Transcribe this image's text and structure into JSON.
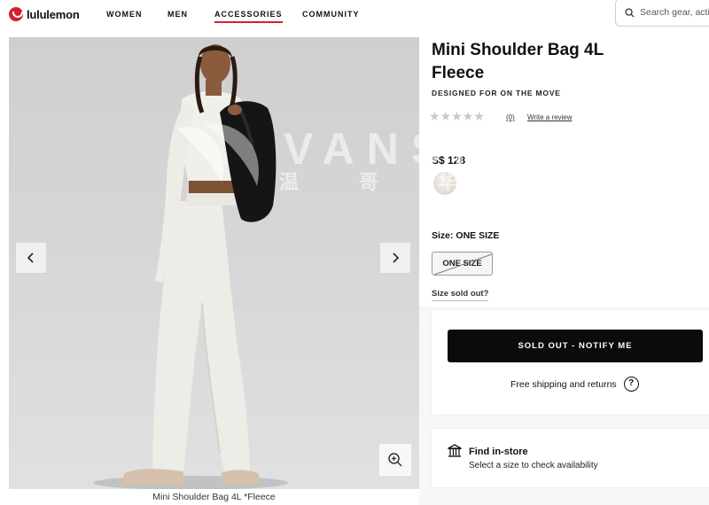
{
  "header": {
    "brand": "lululemon",
    "nav": [
      "WOMEN",
      "MEN",
      "ACCESSORIES",
      "COMMUNITY"
    ],
    "search_placeholder": "Search gear, activ"
  },
  "gallery": {
    "caption": "Mini Shoulder Bag 4L *Fleece",
    "prev_icon": "chevron-left-icon",
    "next_icon": "chevron-right-icon",
    "zoom_icon": "zoom-in-icon"
  },
  "product": {
    "title": "Mini Shoulder Bag 4L Fleece",
    "subtitle": "DESIGNED FOR ON THE MOVE",
    "rating_stars": "★★★★★",
    "review_count": "(0)",
    "write_review": "Write a review",
    "price": "S$ 128",
    "size_label": "Size: ONE SIZE",
    "size_option": "ONE SIZE",
    "size_sold_out_question": "Size sold out?",
    "cta": "SOLD OUT - NOTIFY ME",
    "shipping": "Free shipping and returns",
    "help_icon": "?",
    "store_title": "Find in-store",
    "store_subtitle": "Select a size to check availability"
  },
  "watermark": {
    "latin": "VANSKY",
    "chinese": "温 哥 华 空"
  },
  "colors": {
    "brand_red": "#d22030",
    "cta_bg": "#0b0b0b"
  }
}
